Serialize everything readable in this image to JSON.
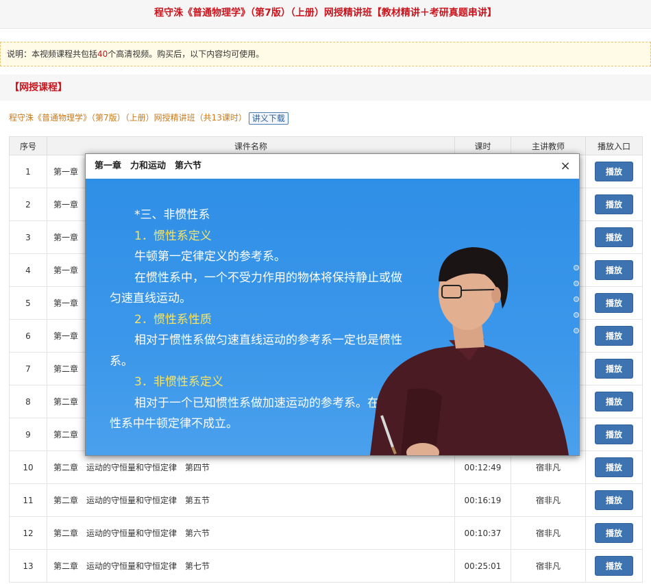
{
  "page_title": "程守洙《普通物理学》（第7版）（上册）网授精讲班【教材精讲＋考研真题串讲】",
  "notice": {
    "prefix": "说明：本视频课程共包括",
    "count": "40",
    "suffix": "个高清视频。购买后，以下内容均可使用。"
  },
  "section_title": "【网授课程】",
  "course": {
    "title": "程守洙《普通物理学》（第7版）（上册）网授精讲班（共13课时）",
    "download_label": "讲义下载"
  },
  "table": {
    "headers": [
      "序号",
      "课件名称",
      "课时",
      "主讲教师",
      "播放入口"
    ],
    "play_label": "播放",
    "rows": [
      {
        "no": "1",
        "name": "第一章",
        "duration": "",
        "teacher": ""
      },
      {
        "no": "2",
        "name": "第一章",
        "duration": "",
        "teacher": ""
      },
      {
        "no": "3",
        "name": "第一章",
        "duration": "",
        "teacher": ""
      },
      {
        "no": "4",
        "name": "第一章",
        "duration": "",
        "teacher": ""
      },
      {
        "no": "5",
        "name": "第一章",
        "duration": "",
        "teacher": ""
      },
      {
        "no": "6",
        "name": "第一章",
        "duration": "",
        "teacher": ""
      },
      {
        "no": "7",
        "name": "第二章",
        "duration": "",
        "teacher": ""
      },
      {
        "no": "8",
        "name": "第二章",
        "duration": "",
        "teacher": ""
      },
      {
        "no": "9",
        "name": "第二章",
        "duration": "",
        "teacher": ""
      },
      {
        "no": "10",
        "name": "第二章　运动的守恒量和守恒定律　第四节",
        "duration": "00:12:49",
        "teacher": "宿非凡"
      },
      {
        "no": "11",
        "name": "第二章　运动的守恒量和守恒定律　第五节",
        "duration": "00:16:19",
        "teacher": "宿非凡"
      },
      {
        "no": "12",
        "name": "第二章　运动的守恒量和守恒定律　第六节",
        "duration": "00:10:37",
        "teacher": "宿非凡"
      },
      {
        "no": "13",
        "name": "第二章　运动的守恒量和守恒定律　第七节",
        "duration": "00:25:01",
        "teacher": "宿非凡"
      }
    ]
  },
  "modal": {
    "title": "第一章　力和运动　第六节",
    "close_symbol": "×",
    "video_lines": [
      {
        "text": "*三、非惯性系",
        "indent": true,
        "highlight": false
      },
      {
        "text": "1．惯性系定义",
        "indent": true,
        "highlight": true
      },
      {
        "text": "牛顿第一定律定义的参考系。",
        "indent": true,
        "highlight": false
      },
      {
        "text": "在惯性系中，一个不受力作用的物体将保持静止或做",
        "indent": true,
        "highlight": false
      },
      {
        "text": "匀速直线运动。",
        "indent": false,
        "highlight": false
      },
      {
        "text": "2．惯性系性质",
        "indent": true,
        "highlight": true
      },
      {
        "text": "相对于惯性系做匀速直线运动的参考系一定也是惯性",
        "indent": true,
        "highlight": false
      },
      {
        "text": "系。",
        "indent": false,
        "highlight": false
      },
      {
        "text": "3．非惯性系定义",
        "indent": true,
        "highlight": true
      },
      {
        "text": "相对于一个已知惯性系做加速运动的参考系。在非惯",
        "indent": true,
        "highlight": false
      },
      {
        "text": "性系中牛顿定律不成立。",
        "indent": false,
        "highlight": false
      }
    ]
  },
  "colors": {
    "accent_red": "#c9151e",
    "button_blue": "#3c73b0",
    "video_blue": "#3b97ea",
    "highlight_yellow": "#f5e36a"
  }
}
